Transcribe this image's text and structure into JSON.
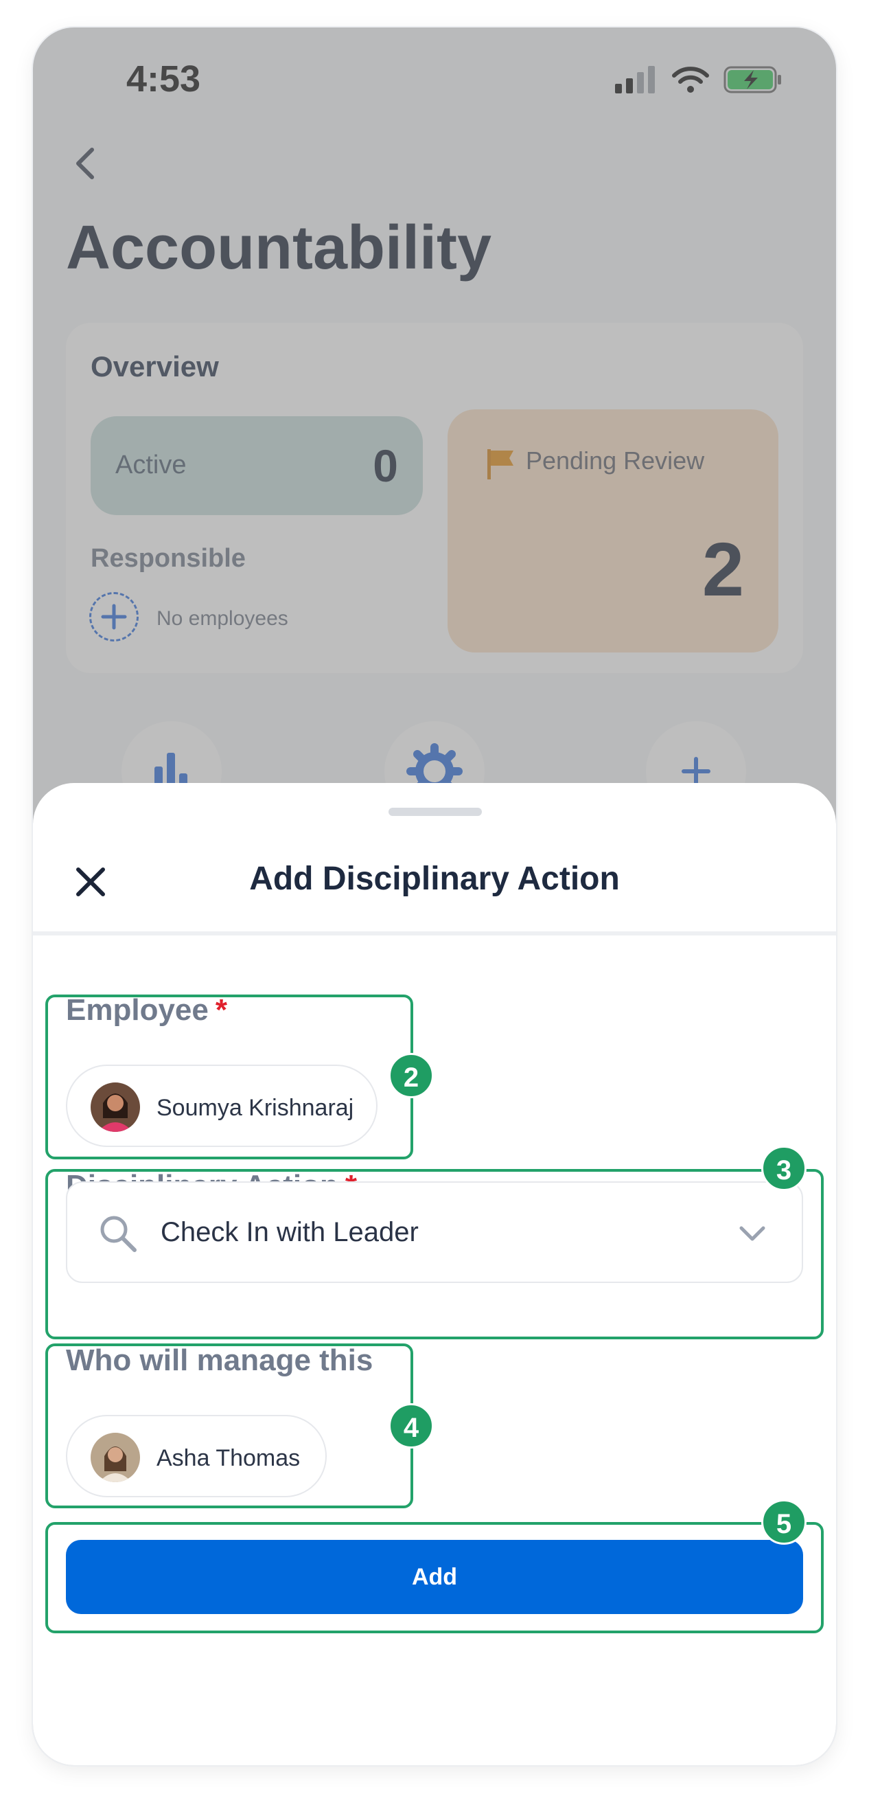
{
  "status_bar": {
    "time": "4:53"
  },
  "background_page": {
    "title": "Accountability",
    "overview": {
      "title": "Overview",
      "active_label": "Active",
      "active_count": "0",
      "pending_label": "Pending Review",
      "pending_count": "2",
      "responsible_label": "Responsible",
      "responsible_empty": "No employees"
    },
    "bottom_icons": [
      "chart-icon",
      "gear-icon",
      "plus-icon"
    ]
  },
  "sheet": {
    "title": "Add Disciplinary Action",
    "employee": {
      "label": "Employee",
      "required_mark": "*",
      "name": "Soumya Krishnaraj"
    },
    "disciplinary_action": {
      "label": "Disciplinary Action",
      "required_mark": "*",
      "value": "Check In with Leader"
    },
    "manager": {
      "label": "Who will manage this",
      "name": "Asha Thomas"
    },
    "add_button": "Add"
  },
  "annotations": [
    "2",
    "3",
    "4",
    "5"
  ],
  "colors": {
    "primary": "#0068da",
    "annotation": "#23a26a",
    "required": "#e0202c",
    "active_box": "#c3d9d6",
    "pending_box": "#f7ddc2"
  }
}
